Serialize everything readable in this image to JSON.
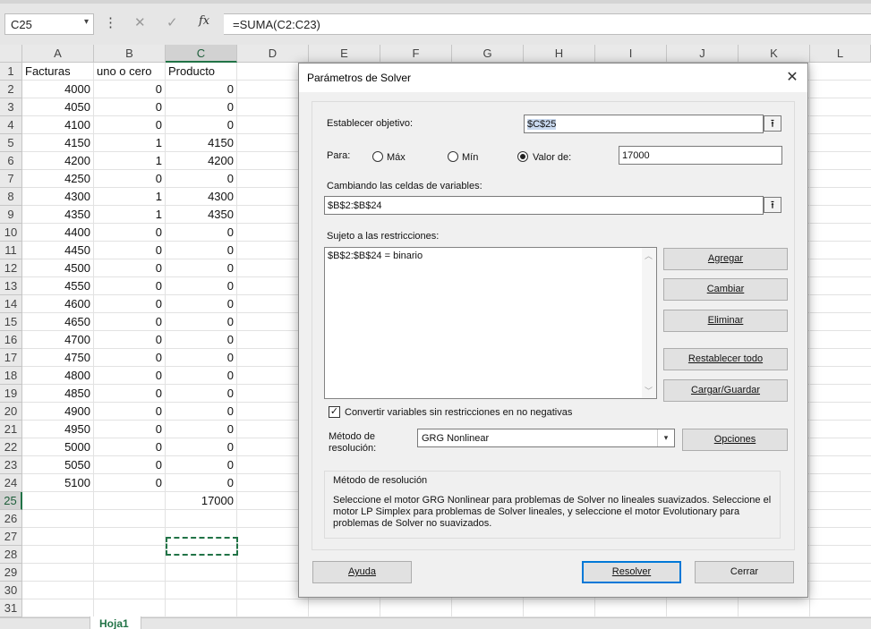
{
  "formula_bar": {
    "name_box": "C25",
    "name_box_arrow": "▾",
    "dots": "⋮",
    "cancel": "✕",
    "enter": "✓",
    "fx": "fx",
    "formula": "=SUMA(C2:C23)"
  },
  "columns": [
    "A",
    "B",
    "C",
    "D",
    "E",
    "F",
    "G",
    "H",
    "I",
    "J",
    "K",
    "L"
  ],
  "selected_column": "C",
  "rows": [
    "1",
    "2",
    "3",
    "4",
    "5",
    "6",
    "7",
    "8",
    "9",
    "10",
    "11",
    "12",
    "13",
    "14",
    "15",
    "16",
    "17",
    "18",
    "19",
    "20",
    "21",
    "22",
    "23",
    "24",
    "25",
    "26",
    "27",
    "28",
    "29",
    "30",
    "31"
  ],
  "selected_row": "25",
  "sheet": {
    "headers": [
      "Facturas",
      "uno o cero",
      "Producto"
    ],
    "data": [
      [
        "4000",
        "0",
        "0"
      ],
      [
        "4050",
        "0",
        "0"
      ],
      [
        "4100",
        "0",
        "0"
      ],
      [
        "4150",
        "1",
        "4150"
      ],
      [
        "4200",
        "1",
        "4200"
      ],
      [
        "4250",
        "0",
        "0"
      ],
      [
        "4300",
        "1",
        "4300"
      ],
      [
        "4350",
        "1",
        "4350"
      ],
      [
        "4400",
        "0",
        "0"
      ],
      [
        "4450",
        "0",
        "0"
      ],
      [
        "4500",
        "0",
        "0"
      ],
      [
        "4550",
        "0",
        "0"
      ],
      [
        "4600",
        "0",
        "0"
      ],
      [
        "4650",
        "0",
        "0"
      ],
      [
        "4700",
        "0",
        "0"
      ],
      [
        "4750",
        "0",
        "0"
      ],
      [
        "4800",
        "0",
        "0"
      ],
      [
        "4850",
        "0",
        "0"
      ],
      [
        "4900",
        "0",
        "0"
      ],
      [
        "4950",
        "0",
        "0"
      ],
      [
        "5000",
        "0",
        "0"
      ],
      [
        "5050",
        "0",
        "0"
      ],
      [
        "5100",
        "0",
        "0"
      ]
    ],
    "total": "17000"
  },
  "tabs": {
    "active": "Hoja1"
  },
  "dialog": {
    "title": "Parámetros de Solver",
    "close": "✕",
    "objective_label": "Establecer objetivo:",
    "objective_value": "$C$25",
    "to_label": "Para:",
    "opt_max": "Máx",
    "opt_min": "Mín",
    "opt_value": "Valor de:",
    "value_of": "17000",
    "selected_option": "value",
    "changing_label": "Cambiando las celdas de variables:",
    "changing_value": "$B$2:$B$24",
    "ref_icon": "⭱",
    "subject_label": "Sujeto a las restricciones:",
    "constraints": [
      "$B$2:$B$24 = binario"
    ],
    "btn_add": "Agregar",
    "btn_change": "Cambiar",
    "btn_delete": "Eliminar",
    "btn_reset": "Restablecer todo",
    "btn_load_save": "Cargar/Guardar",
    "nonneg_label": "Convertir variables sin restricciones en no negativas",
    "nonneg_checked": true,
    "method_label_1": "Método de",
    "method_label_2": "resolución:",
    "method_value": "GRG Nonlinear",
    "btn_options": "Opciones",
    "group_title": "Método de resolución",
    "group_text": "Seleccione el motor GRG Nonlinear para problemas de Solver no lineales suavizados. Seleccione el motor LP Simplex para problemas de Solver lineales, y seleccione el motor Evolutionary para problemas de Solver no suavizados.",
    "btn_help": "Ayuda",
    "btn_solve": "Resolver",
    "btn_close": "Cerrar"
  }
}
